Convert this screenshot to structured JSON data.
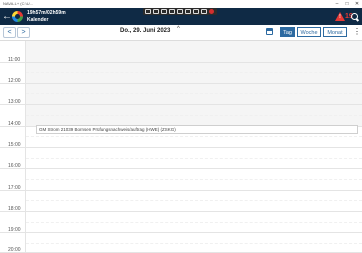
{
  "window": {
    "title": "NAVA-L+ (C:\\U...",
    "min": "–",
    "max": "□",
    "close": "✕"
  },
  "header": {
    "timer": "19h57m/02h59m",
    "section": "Kalender",
    "back_icon": "arrow-left-icon",
    "alert_mark": "!",
    "alert_count": "19",
    "search_icon": "search-icon",
    "brand_color": "#0f2a45",
    "alert_color": "#e53935"
  },
  "nav": {
    "prev": "<",
    "next": ">",
    "date": "Do., 29. Juni 2023",
    "caret": "^",
    "views": [
      "Tag",
      "Woche",
      "Monat"
    ],
    "active_view": "Tag",
    "menu": "⋮",
    "accent_color": "#2d6aa1"
  },
  "calendar": {
    "hours": [
      "11:00",
      "12:00",
      "13:00",
      "14:00",
      "15:00",
      "16:00",
      "17:00",
      "18:00",
      "19:00",
      "20:00"
    ],
    "event_text": "GM Strom 21039 Bornsen Prüfungsnachweis/auftrag (HWE) (ZSKG)"
  }
}
